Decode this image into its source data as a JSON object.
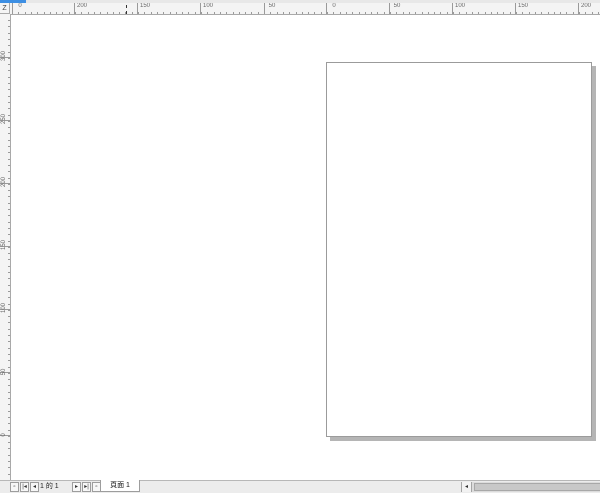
{
  "rulers": {
    "corner_label": "Z",
    "horizontal_labels": [
      "0",
      "200",
      "150",
      "100",
      "50",
      "0",
      "50",
      "100",
      "150",
      "200"
    ],
    "vertical_labels": [
      "300",
      "250",
      "200",
      "150",
      "100",
      "50",
      "0"
    ]
  },
  "statusbar": {
    "page_counter": "1 的 1",
    "page_tab_label": "頁面 1"
  },
  "icons": {
    "add_page_before": "page-add-icon",
    "first_page": "first-page-icon",
    "prev_page": "prev-page-icon",
    "next_page": "next-page-icon",
    "last_page": "last-page-icon",
    "add_page_after": "page-add-icon",
    "scroll_left": "scroll-left-icon"
  }
}
